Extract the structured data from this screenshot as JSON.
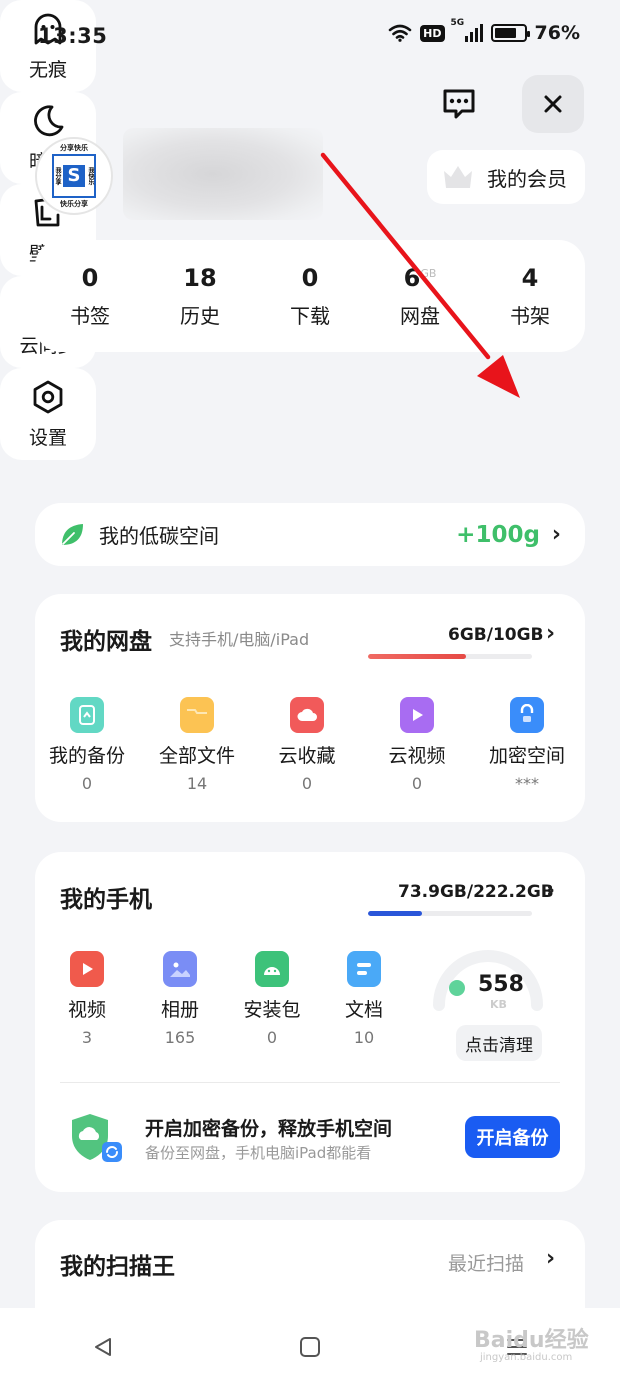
{
  "status": {
    "time": "13:35",
    "hd": "HD",
    "network": "5G",
    "battery": "76%"
  },
  "profile": {
    "vip_label": "我的会员",
    "avatar_logo": {
      "top": "分享快乐",
      "left": "我分享",
      "right": "我快乐",
      "s": "S",
      "bottom": "快乐分享"
    }
  },
  "stats": [
    {
      "value": "0",
      "label": "书签"
    },
    {
      "value": "18",
      "label": "历史"
    },
    {
      "value": "0",
      "label": "下载"
    },
    {
      "value": "6",
      "unit": "GB",
      "label": "网盘"
    },
    {
      "value": "4",
      "label": "书架"
    }
  ],
  "tools": [
    {
      "label": "无痕",
      "icon": "ghost-icon"
    },
    {
      "label": "暗夜",
      "icon": "moon-icon"
    },
    {
      "label": "壁纸",
      "icon": "wallpaper-icon"
    },
    {
      "label": "云同步",
      "icon": "sync-icon"
    },
    {
      "label": "设置",
      "icon": "gear-icon"
    }
  ],
  "carbon": {
    "label": "我的低碳空间",
    "value": "+100g"
  },
  "netdisk": {
    "title": "我的网盘",
    "subtitle": "支持手机/电脑/iPad",
    "usage": "6GB/10GB",
    "usage_fraction": 0.6,
    "items": [
      {
        "label": "我的备份",
        "value": "0",
        "color": "#5fd3c0",
        "icon": "backup-icon"
      },
      {
        "label": "全部文件",
        "value": "14",
        "color": "#fcc353",
        "icon": "folder-icon"
      },
      {
        "label": "云收藏",
        "value": "0",
        "color": "#f15a5a",
        "icon": "cloud-favorite-icon"
      },
      {
        "label": "云视频",
        "value": "0",
        "color": "#a86cf2",
        "icon": "cloud-video-icon"
      },
      {
        "label": "加密空间",
        "value": "***",
        "color": "#3a8dfa",
        "icon": "lock-icon"
      }
    ]
  },
  "phone": {
    "title": "我的手机",
    "usage": "73.9GB/222.2GB",
    "usage_fraction": 0.33,
    "items": [
      {
        "label": "视频",
        "value": "3",
        "color": "#f05a4c",
        "icon": "video-icon"
      },
      {
        "label": "相册",
        "value": "165",
        "color": "#7a8df5",
        "icon": "album-icon"
      },
      {
        "label": "安装包",
        "value": "0",
        "color": "#3dc27a",
        "icon": "android-icon"
      },
      {
        "label": "文档",
        "value": "10",
        "color": "#4aa9f7",
        "icon": "document-icon"
      }
    ],
    "junk_value": "558",
    "junk_unit": "KB",
    "clean_label": "点击清理",
    "backup_title": "开启加密备份，释放手机空间",
    "backup_sub": "备份至网盘，手机电脑iPad都能看",
    "backup_button": "开启备份"
  },
  "scan": {
    "title": "我的扫描王",
    "recent": "最近扫描"
  },
  "watermark": "Baidu经验",
  "watermark_url": "jingyan.baidu.com"
}
